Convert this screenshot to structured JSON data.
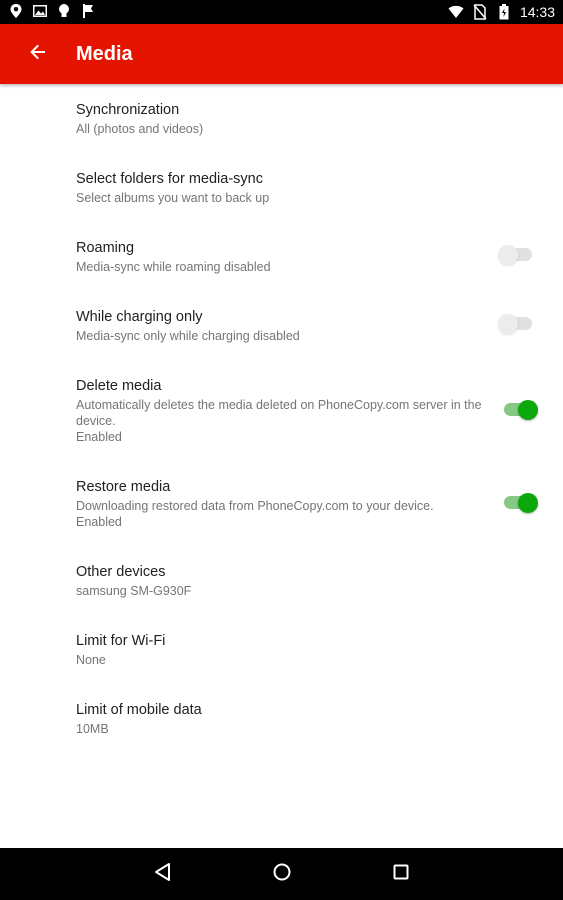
{
  "status_bar": {
    "time": "14:33",
    "left_icons": [
      "location-pin-icon",
      "photo-icon",
      "lightbulb-icon",
      "flag-icon"
    ],
    "right_icons": [
      "wifi-icon",
      "no-sim-icon",
      "battery-icon"
    ]
  },
  "app_bar": {
    "back_icon": "arrow-left-icon",
    "title": "Media",
    "background": "#e51400"
  },
  "settings": [
    {
      "title": "Synchronization",
      "summary": "All (photos and videos)"
    },
    {
      "title": "Select folders for media-sync",
      "summary": "Select albums you want to back up"
    },
    {
      "title": "Roaming",
      "summary": "Media-sync while roaming disabled",
      "switch": false
    },
    {
      "title": "While charging only",
      "summary": "Media-sync only while charging disabled",
      "switch": false
    },
    {
      "title": "Delete media",
      "summary": "Automatically deletes the media deleted on PhoneCopy.com server in the device.",
      "status": "Enabled",
      "switch": true
    },
    {
      "title": "Restore media",
      "summary": "Downloading restored data from PhoneCopy.com to your device.",
      "status": "Enabled",
      "switch": true
    },
    {
      "title": "Other devices",
      "summary": "samsung SM-G930F"
    },
    {
      "title": "Limit for Wi-Fi",
      "summary": "None"
    },
    {
      "title": "Limit of mobile data",
      "summary": "10MB"
    }
  ],
  "colors": {
    "accent": "#e51400",
    "switch_on": "#0ba70b"
  },
  "nav_bar": {
    "icons": [
      "back-triangle-icon",
      "home-circle-icon",
      "recents-square-icon"
    ]
  }
}
